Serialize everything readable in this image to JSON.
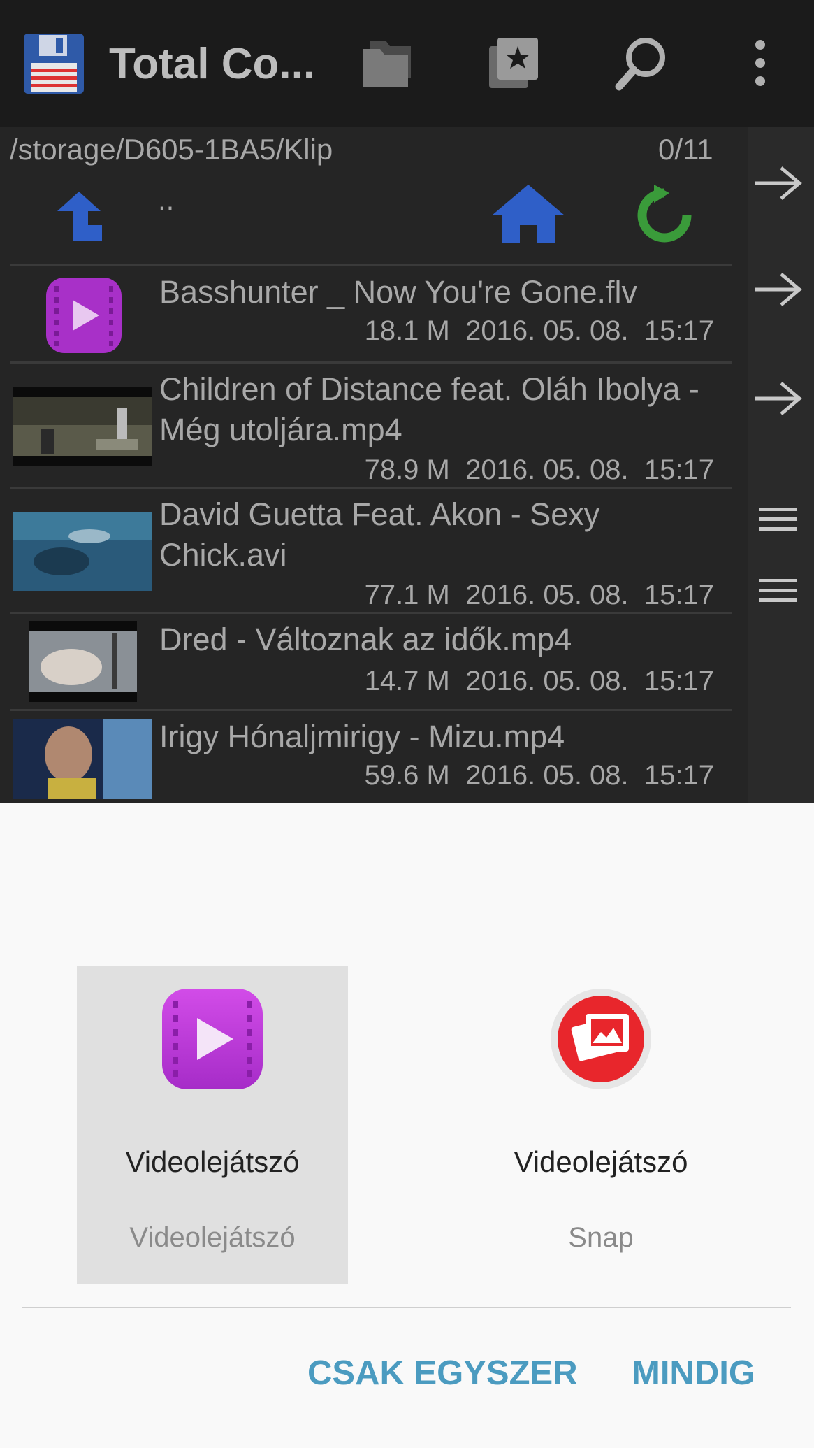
{
  "appbar": {
    "title": "Total Co...",
    "icons": [
      "floppy-disk-icon",
      "folders-icon",
      "bookmarks-icon",
      "search-icon",
      "overflow-menu-icon"
    ]
  },
  "pathbar": {
    "path": "/storage/D605-1BA5/Klip",
    "counter": "0/11",
    "parent": ".."
  },
  "files": [
    {
      "name": "Basshunter _ Now You're Gone.flv",
      "size": "18.1 M",
      "date": "2016. 05. 08.",
      "time": "15:17"
    },
    {
      "name": "Children of Distance feat. Oláh Ibolya -  Még utoljára.mp4",
      "size": "78.9 M",
      "date": "2016. 05. 08.",
      "time": "15:17"
    },
    {
      "name": "David Guetta Feat. Akon - Sexy Chick.avi",
      "size": "77.1 M",
      "date": "2016. 05. 08.",
      "time": "15:17"
    },
    {
      "name": "Dred - Változnak az idők.mp4",
      "size": "14.7 M",
      "date": "2016. 05. 08.",
      "time": "15:17"
    },
    {
      "name": "Irigy Hónaljmirigy - Mizu.mp4",
      "size": "59.6 M",
      "date": "2016. 05. 08.",
      "time": "15:17"
    }
  ],
  "chooser": {
    "apps": [
      {
        "label": "Videolejátszó",
        "sub": "Videolejátszó",
        "selected": true
      },
      {
        "label": "Videolejátszó",
        "sub": "Snap",
        "selected": false
      }
    ],
    "just_once": "CSAK EGYSZER",
    "always": "MINDIG"
  },
  "colors": {
    "accent": "#4b9bc0",
    "player_purple": "#c13de0",
    "snap_red": "#e8262c",
    "home_blue": "#2f5fc8",
    "refresh_green": "#3a9b3a"
  }
}
